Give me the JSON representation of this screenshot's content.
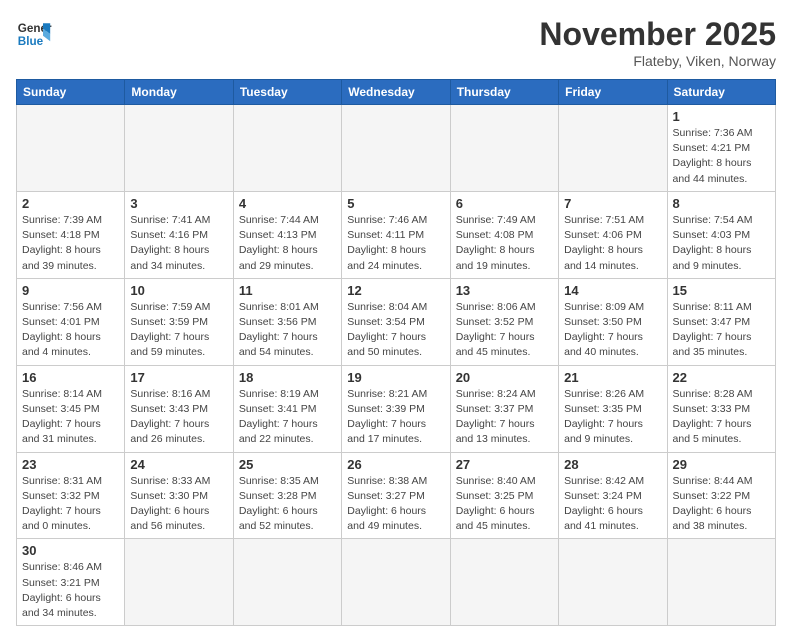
{
  "header": {
    "logo_general": "General",
    "logo_blue": "Blue",
    "month_title": "November 2025",
    "location": "Flateby, Viken, Norway"
  },
  "weekdays": [
    "Sunday",
    "Monday",
    "Tuesday",
    "Wednesday",
    "Thursday",
    "Friday",
    "Saturday"
  ],
  "weeks": [
    [
      {
        "day": "",
        "info": ""
      },
      {
        "day": "",
        "info": ""
      },
      {
        "day": "",
        "info": ""
      },
      {
        "day": "",
        "info": ""
      },
      {
        "day": "",
        "info": ""
      },
      {
        "day": "",
        "info": ""
      },
      {
        "day": "1",
        "info": "Sunrise: 7:36 AM\nSunset: 4:21 PM\nDaylight: 8 hours\nand 44 minutes."
      }
    ],
    [
      {
        "day": "2",
        "info": "Sunrise: 7:39 AM\nSunset: 4:18 PM\nDaylight: 8 hours\nand 39 minutes."
      },
      {
        "day": "3",
        "info": "Sunrise: 7:41 AM\nSunset: 4:16 PM\nDaylight: 8 hours\nand 34 minutes."
      },
      {
        "day": "4",
        "info": "Sunrise: 7:44 AM\nSunset: 4:13 PM\nDaylight: 8 hours\nand 29 minutes."
      },
      {
        "day": "5",
        "info": "Sunrise: 7:46 AM\nSunset: 4:11 PM\nDaylight: 8 hours\nand 24 minutes."
      },
      {
        "day": "6",
        "info": "Sunrise: 7:49 AM\nSunset: 4:08 PM\nDaylight: 8 hours\nand 19 minutes."
      },
      {
        "day": "7",
        "info": "Sunrise: 7:51 AM\nSunset: 4:06 PM\nDaylight: 8 hours\nand 14 minutes."
      },
      {
        "day": "8",
        "info": "Sunrise: 7:54 AM\nSunset: 4:03 PM\nDaylight: 8 hours\nand 9 minutes."
      }
    ],
    [
      {
        "day": "9",
        "info": "Sunrise: 7:56 AM\nSunset: 4:01 PM\nDaylight: 8 hours\nand 4 minutes."
      },
      {
        "day": "10",
        "info": "Sunrise: 7:59 AM\nSunset: 3:59 PM\nDaylight: 7 hours\nand 59 minutes."
      },
      {
        "day": "11",
        "info": "Sunrise: 8:01 AM\nSunset: 3:56 PM\nDaylight: 7 hours\nand 54 minutes."
      },
      {
        "day": "12",
        "info": "Sunrise: 8:04 AM\nSunset: 3:54 PM\nDaylight: 7 hours\nand 50 minutes."
      },
      {
        "day": "13",
        "info": "Sunrise: 8:06 AM\nSunset: 3:52 PM\nDaylight: 7 hours\nand 45 minutes."
      },
      {
        "day": "14",
        "info": "Sunrise: 8:09 AM\nSunset: 3:50 PM\nDaylight: 7 hours\nand 40 minutes."
      },
      {
        "day": "15",
        "info": "Sunrise: 8:11 AM\nSunset: 3:47 PM\nDaylight: 7 hours\nand 35 minutes."
      }
    ],
    [
      {
        "day": "16",
        "info": "Sunrise: 8:14 AM\nSunset: 3:45 PM\nDaylight: 7 hours\nand 31 minutes."
      },
      {
        "day": "17",
        "info": "Sunrise: 8:16 AM\nSunset: 3:43 PM\nDaylight: 7 hours\nand 26 minutes."
      },
      {
        "day": "18",
        "info": "Sunrise: 8:19 AM\nSunset: 3:41 PM\nDaylight: 7 hours\nand 22 minutes."
      },
      {
        "day": "19",
        "info": "Sunrise: 8:21 AM\nSunset: 3:39 PM\nDaylight: 7 hours\nand 17 minutes."
      },
      {
        "day": "20",
        "info": "Sunrise: 8:24 AM\nSunset: 3:37 PM\nDaylight: 7 hours\nand 13 minutes."
      },
      {
        "day": "21",
        "info": "Sunrise: 8:26 AM\nSunset: 3:35 PM\nDaylight: 7 hours\nand 9 minutes."
      },
      {
        "day": "22",
        "info": "Sunrise: 8:28 AM\nSunset: 3:33 PM\nDaylight: 7 hours\nand 5 minutes."
      }
    ],
    [
      {
        "day": "23",
        "info": "Sunrise: 8:31 AM\nSunset: 3:32 PM\nDaylight: 7 hours\nand 0 minutes."
      },
      {
        "day": "24",
        "info": "Sunrise: 8:33 AM\nSunset: 3:30 PM\nDaylight: 6 hours\nand 56 minutes."
      },
      {
        "day": "25",
        "info": "Sunrise: 8:35 AM\nSunset: 3:28 PM\nDaylight: 6 hours\nand 52 minutes."
      },
      {
        "day": "26",
        "info": "Sunrise: 8:38 AM\nSunset: 3:27 PM\nDaylight: 6 hours\nand 49 minutes."
      },
      {
        "day": "27",
        "info": "Sunrise: 8:40 AM\nSunset: 3:25 PM\nDaylight: 6 hours\nand 45 minutes."
      },
      {
        "day": "28",
        "info": "Sunrise: 8:42 AM\nSunset: 3:24 PM\nDaylight: 6 hours\nand 41 minutes."
      },
      {
        "day": "29",
        "info": "Sunrise: 8:44 AM\nSunset: 3:22 PM\nDaylight: 6 hours\nand 38 minutes."
      }
    ],
    [
      {
        "day": "30",
        "info": "Sunrise: 8:46 AM\nSunset: 3:21 PM\nDaylight: 6 hours\nand 34 minutes."
      },
      {
        "day": "",
        "info": ""
      },
      {
        "day": "",
        "info": ""
      },
      {
        "day": "",
        "info": ""
      },
      {
        "day": "",
        "info": ""
      },
      {
        "day": "",
        "info": ""
      },
      {
        "day": "",
        "info": ""
      }
    ]
  ]
}
